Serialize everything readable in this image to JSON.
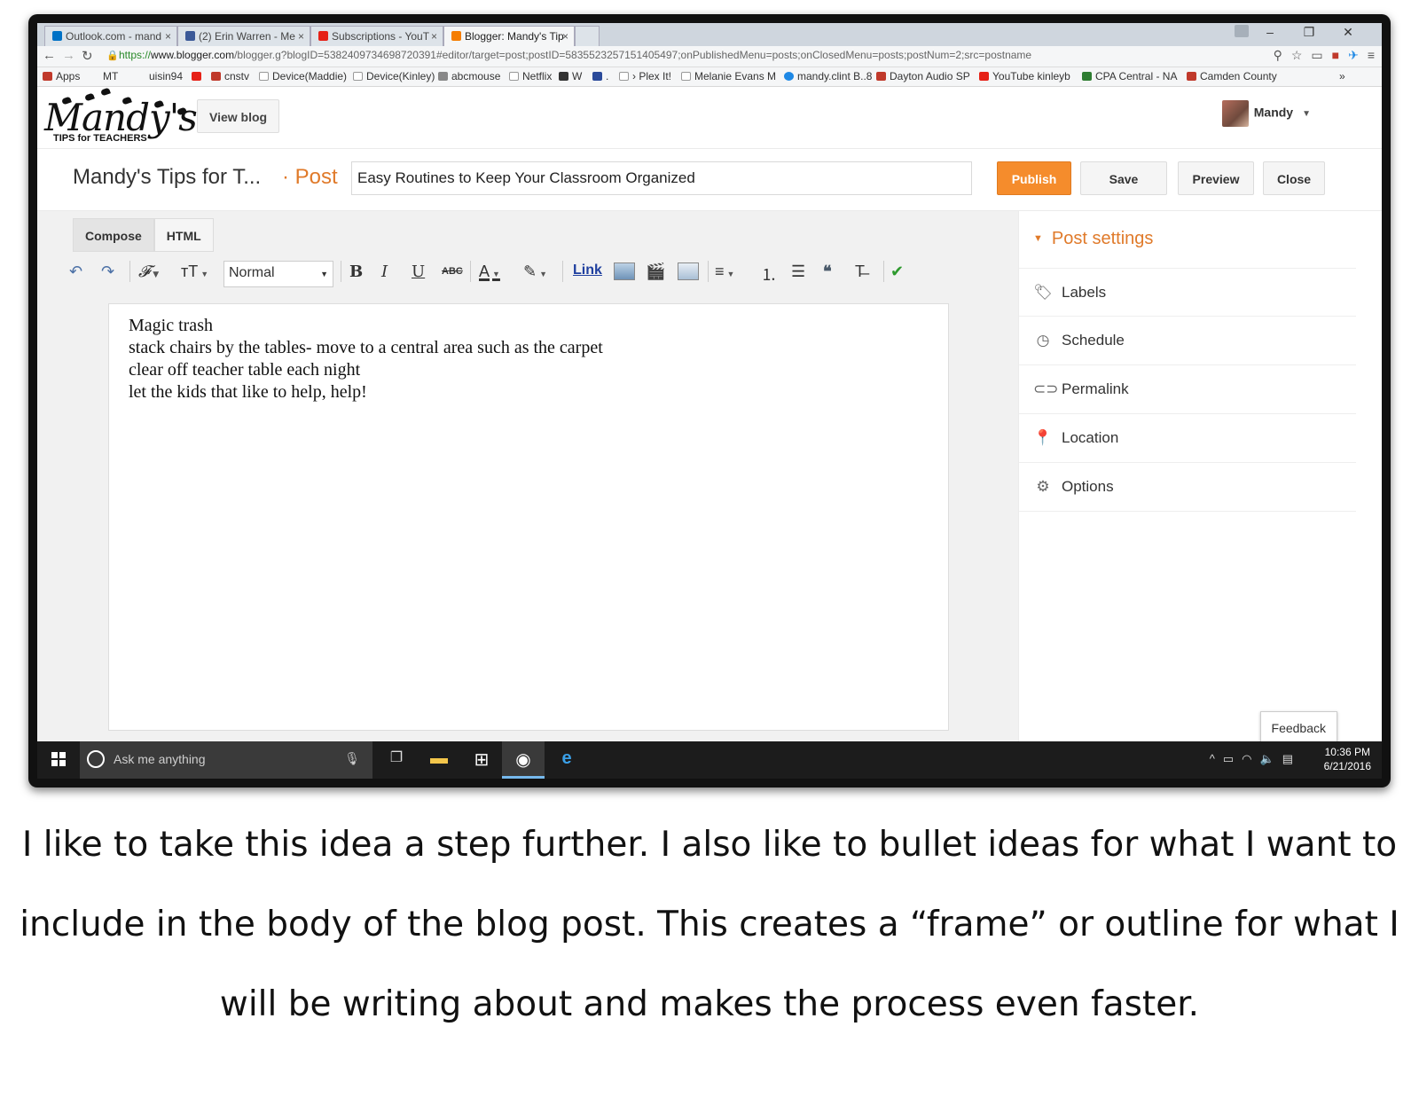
{
  "browser": {
    "tabs": [
      {
        "label": "Outlook.com - mand",
        "favicon_color": "#0072c6"
      },
      {
        "label": "(2) Erin Warren - Me",
        "favicon_color": "#3b5998"
      },
      {
        "label": "Subscriptions - YouT",
        "favicon_color": "#e62117"
      },
      {
        "label": "Blogger: Mandy's Tip",
        "favicon_color": "#f57d00"
      }
    ],
    "url_https": "https://",
    "url_host": "www.blogger.com",
    "url_rest": "/blogger.g?blogID=5382409734698720391#editor/target=post;postID=5835523257151405497;onPublishedMenu=posts;onClosedMenu=posts;postNum=2;src=postname",
    "bookmarks": [
      {
        "label": "Apps",
        "color": "#c0392b"
      },
      {
        "label": "MT",
        "color": "#555555"
      },
      {
        "label": "uisin94",
        "color": "#888888"
      },
      {
        "label": "",
        "color": "#e62117"
      },
      {
        "label": "cnstv",
        "color": "#c0392b"
      },
      {
        "label": "Device(Maddie)",
        "color": "#999999"
      },
      {
        "label": "Device(Kinley)",
        "color": "#999999"
      },
      {
        "label": "abcmouse",
        "color": "#888888"
      },
      {
        "label": "Netflix",
        "color": "#999999"
      },
      {
        "label": "W",
        "color": "#333333"
      },
      {
        "label": ".",
        "color": "#2a4a9a"
      },
      {
        "label": "› Plex It!",
        "color": "#999999"
      },
      {
        "label": "Melanie Evans M",
        "color": "#999999"
      },
      {
        "label": "mandy.clint B..8",
        "color": "#1e88e5"
      },
      {
        "label": "Dayton Audio SP",
        "color": "#c0392b"
      },
      {
        "label": "YouTube  kinleyb",
        "color": "#e62117"
      },
      {
        "label": "CPA Central - NA",
        "color": "#2e7d32"
      },
      {
        "label": "Camden County",
        "color": "#c0392b"
      }
    ]
  },
  "header": {
    "logo_text": "Mandy's",
    "logo_sub": "TIPS for TEACHERS",
    "view_blog": "View blog",
    "user_name": "Mandy"
  },
  "post": {
    "blog_name": "Mandy's Tips for T...",
    "separator_label": "· Post",
    "title_value": "Easy Routines to Keep Your Classroom Organized",
    "buttons": {
      "publish": "Publish",
      "save": "Save",
      "preview": "Preview",
      "close": "Close"
    }
  },
  "editor": {
    "modes": {
      "compose": "Compose",
      "html": "HTML"
    },
    "format_select": "Normal",
    "link_label": "Link",
    "body_lines": [
      "Magic trash",
      "stack chairs by the tables- move to a central area such as the carpet",
      "clear off teacher table each night",
      "let the kids that like to help, help!"
    ]
  },
  "settings": {
    "heading": "Post settings",
    "items": [
      {
        "label": "Labels",
        "icon": "tag-icon"
      },
      {
        "label": "Schedule",
        "icon": "clock-icon"
      },
      {
        "label": "Permalink",
        "icon": "link-icon"
      },
      {
        "label": "Location",
        "icon": "map-pin-icon"
      },
      {
        "label": "Options",
        "icon": "gear-icon"
      }
    ],
    "feedback": "Feedback"
  },
  "taskbar": {
    "search_placeholder": "Ask me anything",
    "time": "10:36 PM",
    "date": "6/21/2016"
  },
  "caption": {
    "line1": "I like to take this idea a step further.  I also like to bullet ideas for what I want to",
    "line2": "include in the body of the blog post. This creates a “frame” or outline for what I",
    "line3": "will be writing about and makes the process even faster."
  }
}
